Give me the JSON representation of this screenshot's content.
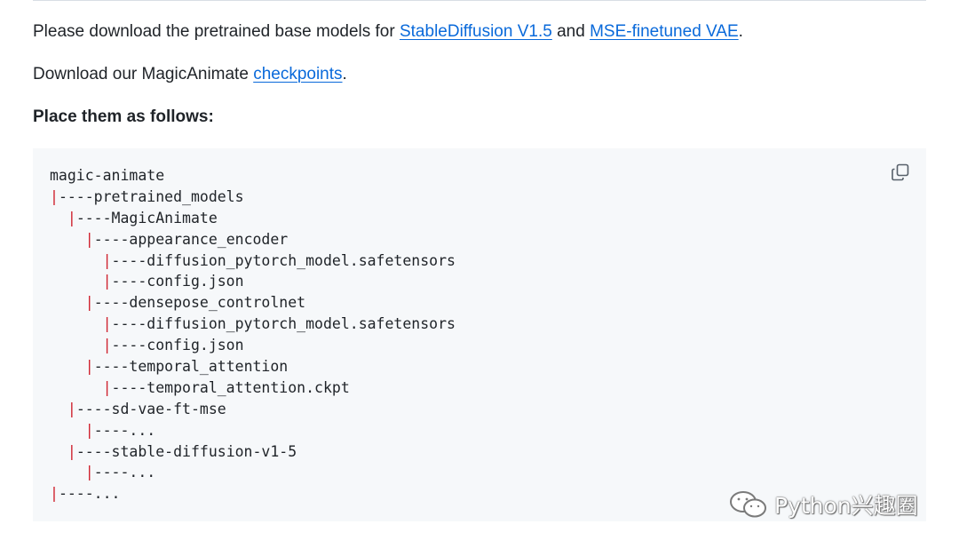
{
  "intro": {
    "before": "Please download the pretrained base models for ",
    "link1": "StableDiffusion V1.5",
    "middle": " and ",
    "link2": "MSE-finetuned VAE",
    "after": "."
  },
  "download": {
    "before": "Download our MagicAnimate ",
    "link": "checkpoints",
    "after": "."
  },
  "heading": "Place them as follows:",
  "code_lines": [
    {
      "indent": "",
      "pipe": "",
      "text": "magic-animate"
    },
    {
      "indent": "",
      "pipe": "|",
      "text": "----pretrained_models"
    },
    {
      "indent": "  ",
      "pipe": "|",
      "text": "----MagicAnimate"
    },
    {
      "indent": "    ",
      "pipe": "|",
      "text": "----appearance_encoder"
    },
    {
      "indent": "      ",
      "pipe": "|",
      "text": "----diffusion_pytorch_model.safetensors"
    },
    {
      "indent": "      ",
      "pipe": "|",
      "text": "----config.json"
    },
    {
      "indent": "    ",
      "pipe": "|",
      "text": "----densepose_controlnet"
    },
    {
      "indent": "      ",
      "pipe": "|",
      "text": "----diffusion_pytorch_model.safetensors"
    },
    {
      "indent": "      ",
      "pipe": "|",
      "text": "----config.json"
    },
    {
      "indent": "    ",
      "pipe": "|",
      "text": "----temporal_attention"
    },
    {
      "indent": "      ",
      "pipe": "|",
      "text": "----temporal_attention.ckpt"
    },
    {
      "indent": "  ",
      "pipe": "|",
      "text": "----sd-vae-ft-mse"
    },
    {
      "indent": "    ",
      "pipe": "|",
      "text": "----..."
    },
    {
      "indent": "  ",
      "pipe": "|",
      "text": "----stable-diffusion-v1-5"
    },
    {
      "indent": "    ",
      "pipe": "|",
      "text": "----..."
    },
    {
      "indent": "",
      "pipe": "|",
      "text": "----..."
    }
  ],
  "copy_icon": "copy-icon",
  "watermark": {
    "icon": "wechat-icon",
    "text": "Python兴趣圈"
  },
  "colors": {
    "link": "#0969da",
    "text": "#1f2328",
    "code_bg": "#f6f8fa",
    "pipe": "#cf222e"
  }
}
